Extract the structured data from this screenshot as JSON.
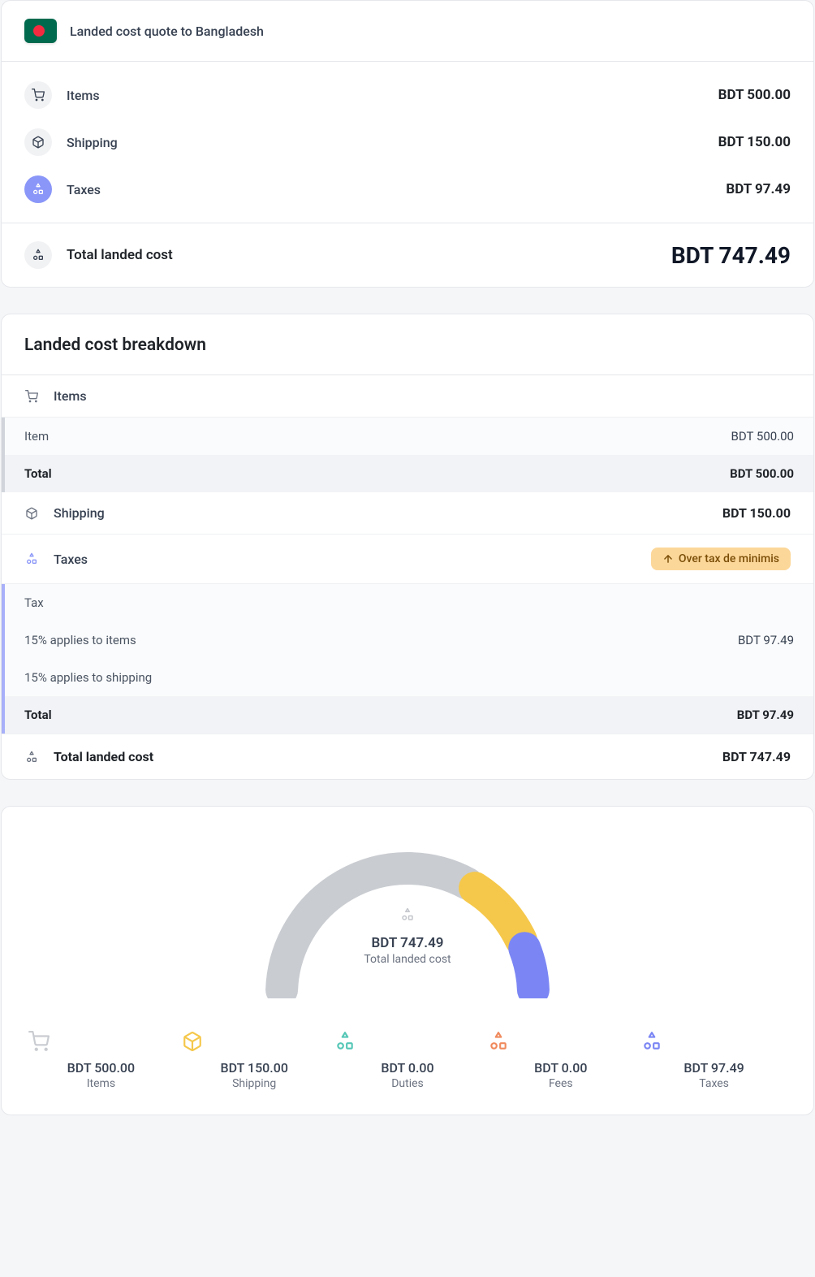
{
  "quote": {
    "title": "Landed cost quote to Bangladesh",
    "rows": {
      "items": {
        "label": "Items",
        "value": "BDT 500.00"
      },
      "shipping": {
        "label": "Shipping",
        "value": "BDT 150.00"
      },
      "taxes": {
        "label": "Taxes",
        "value": "BDT 97.49"
      }
    },
    "total": {
      "label": "Total landed cost",
      "value": "BDT 747.49"
    }
  },
  "breakdown": {
    "title": "Landed cost breakdown",
    "items": {
      "label": "Items",
      "rows": [
        {
          "label": "Item",
          "value": "BDT 500.00"
        }
      ],
      "total": {
        "label": "Total",
        "value": "BDT 500.00"
      }
    },
    "shipping": {
      "label": "Shipping",
      "value": "BDT 150.00"
    },
    "taxes": {
      "label": "Taxes",
      "pill": "Over tax de minimis",
      "rows": [
        {
          "label": "Tax",
          "value": ""
        },
        {
          "label": "15% applies to items",
          "value": "BDT 97.49"
        },
        {
          "label": "15% applies to shipping",
          "value": ""
        }
      ],
      "total": {
        "label": "Total",
        "value": "BDT 97.49"
      }
    },
    "final": {
      "label": "Total landed cost",
      "value": "BDT 747.49"
    }
  },
  "gauge": {
    "center_value": "BDT 747.49",
    "center_label": "Total landed cost",
    "legend": {
      "items": {
        "value": "BDT 500.00",
        "label": "Items"
      },
      "shipping": {
        "value": "BDT 150.00",
        "label": "Shipping"
      },
      "duties": {
        "value": "BDT 0.00",
        "label": "Duties"
      },
      "fees": {
        "value": "BDT 0.00",
        "label": "Fees"
      },
      "taxes": {
        "value": "BDT 97.49",
        "label": "Taxes"
      }
    }
  },
  "chart_data": {
    "type": "pie",
    "title": "Total landed cost",
    "categories": [
      "Items",
      "Shipping",
      "Duties",
      "Fees",
      "Taxes"
    ],
    "values": [
      500.0,
      150.0,
      0.0,
      0.0,
      97.49
    ],
    "currency": "BDT",
    "total": 747.49,
    "colors": [
      "#c9ccd1",
      "#f5c84b",
      "#56c7b7",
      "#f08a5d",
      "#7b86f4"
    ]
  }
}
